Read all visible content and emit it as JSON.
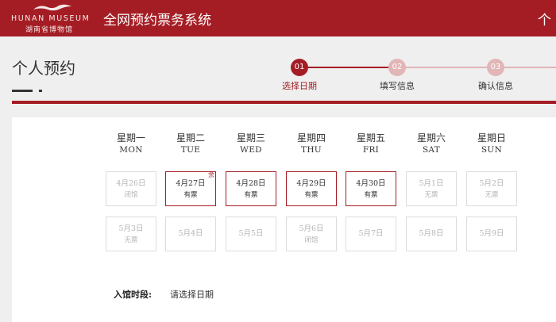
{
  "header": {
    "logo_en": "HUNAN MUSEUM",
    "logo_cn": "湖南省博物馆",
    "system_title": "全网预约票务系统",
    "right_text": "个",
    "bg_color": "#a51d24"
  },
  "page": {
    "title": "个人预约"
  },
  "steps": [
    {
      "number": "01",
      "label": "选择日期",
      "active": true
    },
    {
      "number": "02",
      "label": "填写信息",
      "active": false
    },
    {
      "number": "03",
      "label": "确认信息",
      "active": false
    }
  ],
  "weekdays": [
    {
      "cn": "星期一",
      "en": "MON"
    },
    {
      "cn": "星期二",
      "en": "TUE"
    },
    {
      "cn": "星期三",
      "en": "WED"
    },
    {
      "cn": "星期四",
      "en": "THU"
    },
    {
      "cn": "星期五",
      "en": "FRI"
    },
    {
      "cn": "星期六",
      "en": "SAT"
    },
    {
      "cn": "星期日",
      "en": "SUN"
    }
  ],
  "calendar": {
    "row1": [
      {
        "date": "4月26日",
        "status": "闭馆",
        "available": false
      },
      {
        "date": "4月27日",
        "status": "有票",
        "available": true,
        "flag": "余"
      },
      {
        "date": "4月28日",
        "status": "有票",
        "available": true
      },
      {
        "date": "4月29日",
        "status": "有票",
        "available": true
      },
      {
        "date": "4月30日",
        "status": "有票",
        "available": true
      },
      {
        "date": "5月1日",
        "status": "无票",
        "available": false
      },
      {
        "date": "5月2日",
        "status": "无票",
        "available": false
      }
    ],
    "row2": [
      {
        "date": "5月3日",
        "status": "无票",
        "available": false
      },
      {
        "date": "5月4日",
        "status": "",
        "available": false
      },
      {
        "date": "5月5日",
        "status": "",
        "available": false
      },
      {
        "date": "5月6日",
        "status": "闭馆",
        "available": false
      },
      {
        "date": "5月7日",
        "status": "",
        "available": false
      },
      {
        "date": "5月8日",
        "status": "",
        "available": false
      },
      {
        "date": "5月9日",
        "status": "",
        "available": false
      }
    ]
  },
  "entry": {
    "label": "入馆时段:",
    "value": "请选择日期"
  },
  "colors": {
    "accent": "#a51d24",
    "step_inactive": "#e2b5b7",
    "cell_border": "#dcdcdc",
    "disabled_text": "#b5b5b5"
  }
}
